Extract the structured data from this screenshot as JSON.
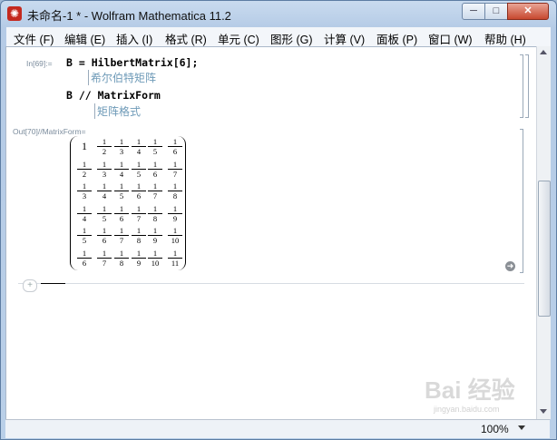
{
  "window": {
    "title": "未命名-1 * - Wolfram Mathematica 11.2",
    "controls": {
      "minimize": "─",
      "maximize": "□",
      "close": "✕"
    }
  },
  "menu": [
    {
      "label": "文件 (F)"
    },
    {
      "label": "编辑 (E)"
    },
    {
      "label": "插入 (I)"
    },
    {
      "label": "格式 (R)"
    },
    {
      "label": "单元 (C)"
    },
    {
      "label": "图形 (G)"
    },
    {
      "label": "计算 (V)"
    },
    {
      "label": "面板 (P)"
    },
    {
      "label": "窗口 (W)"
    },
    {
      "label": "帮助 (H)"
    }
  ],
  "notebook": {
    "input_label": "In[69]:=",
    "line1_code": "B = HilbertMatrix[6];",
    "line1_comment": "希尔伯特矩阵",
    "line2_code": "B // MatrixForm",
    "line2_comment": "矩阵格式",
    "output_label": "Out[70]//MatrixForm=",
    "matrix": [
      [
        "1",
        "1/2",
        "1/3",
        "1/4",
        "1/5",
        "1/6"
      ],
      [
        "1/2",
        "1/3",
        "1/4",
        "1/5",
        "1/6",
        "1/7"
      ],
      [
        "1/3",
        "1/4",
        "1/5",
        "1/6",
        "1/7",
        "1/8"
      ],
      [
        "1/4",
        "1/5",
        "1/6",
        "1/7",
        "1/8",
        "1/9"
      ],
      [
        "1/5",
        "1/6",
        "1/7",
        "1/8",
        "1/9",
        "1/10"
      ],
      [
        "1/6",
        "1/7",
        "1/8",
        "1/9",
        "1/10",
        "1/11"
      ]
    ],
    "insert_button": "+"
  },
  "status": {
    "zoom": "100%"
  },
  "watermark": {
    "main": "Bai 经验",
    "sub": "jingyan.baidu.com"
  },
  "icons": {
    "app": "mathematica-icon",
    "go": "arrow-right-circle-icon"
  }
}
